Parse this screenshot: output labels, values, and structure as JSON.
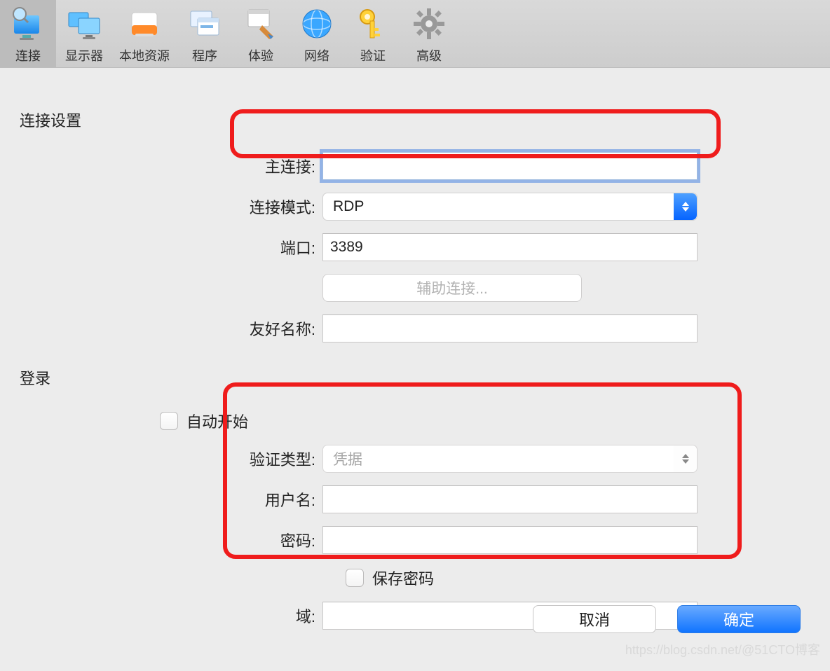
{
  "toolbar": {
    "items": [
      {
        "id": "connection",
        "label": "连接"
      },
      {
        "id": "display",
        "label": "显示器"
      },
      {
        "id": "local-res",
        "label": "本地资源"
      },
      {
        "id": "program",
        "label": "程序"
      },
      {
        "id": "experience",
        "label": "体验"
      },
      {
        "id": "network",
        "label": "网络"
      },
      {
        "id": "auth",
        "label": "验证"
      },
      {
        "id": "advanced",
        "label": "高级"
      }
    ]
  },
  "section_connection_title": "连接设置",
  "labels": {
    "main_connection": "主连接:",
    "mode": "连接模式:",
    "port": "端口:",
    "aux": "辅助连接...",
    "friendly": "友好名称:",
    "auto_start": "自动开始",
    "auth_type": "验证类型:",
    "username": "用户名:",
    "password": "密码:",
    "save_password": "保存密码",
    "domain": "域:"
  },
  "values": {
    "main_connection": "",
    "mode": "RDP",
    "port": "3389",
    "friendly": "",
    "auth_type": "凭据",
    "username": "",
    "password": "",
    "domain": ""
  },
  "section_login_title": "登录",
  "footer": {
    "cancel": "取消",
    "ok": "确定"
  },
  "watermark": "https://blog.csdn.net/@51CTO博客"
}
